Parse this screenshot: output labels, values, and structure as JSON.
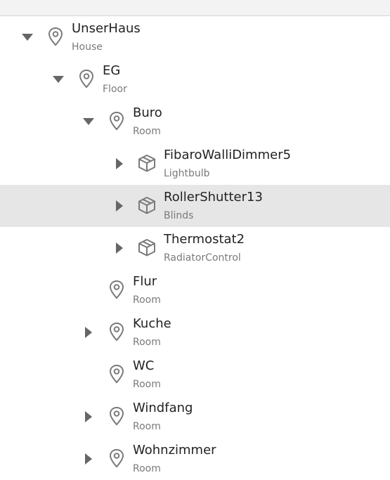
{
  "colors": {
    "toggle": "#666666",
    "icon": "#7a7a7a",
    "selected_bg": "#e6e6e6",
    "name_text": "#222222",
    "type_text": "#7a7a7a"
  },
  "tree": {
    "nodes": [
      {
        "name": "UnserHaus",
        "type": "House",
        "icon": "location-pin-icon",
        "toggle": "expanded",
        "selected": false
      },
      {
        "name": "EG",
        "type": "Floor",
        "icon": "location-pin-icon",
        "toggle": "expanded",
        "selected": false
      },
      {
        "name": "Buro",
        "type": "Room",
        "icon": "location-pin-icon",
        "toggle": "expanded",
        "selected": false
      },
      {
        "name": "FibaroWalliDimmer5",
        "type": "Lightbulb",
        "icon": "cube-icon",
        "toggle": "collapsed",
        "selected": false
      },
      {
        "name": "RollerShutter13",
        "type": "Blinds",
        "icon": "cube-icon",
        "toggle": "collapsed",
        "selected": true
      },
      {
        "name": "Thermostat2",
        "type": "RadiatorControl",
        "icon": "cube-icon",
        "toggle": "collapsed",
        "selected": false
      },
      {
        "name": "Flur",
        "type": "Room",
        "icon": "location-pin-icon",
        "toggle": "none",
        "selected": false
      },
      {
        "name": "Kuche",
        "type": "Room",
        "icon": "location-pin-icon",
        "toggle": "collapsed",
        "selected": false
      },
      {
        "name": "WC",
        "type": "Room",
        "icon": "location-pin-icon",
        "toggle": "none",
        "selected": false
      },
      {
        "name": "Windfang",
        "type": "Room",
        "icon": "location-pin-icon",
        "toggle": "collapsed",
        "selected": false
      },
      {
        "name": "Wohnzimmer",
        "type": "Room",
        "icon": "location-pin-icon",
        "toggle": "collapsed",
        "selected": false
      }
    ]
  }
}
